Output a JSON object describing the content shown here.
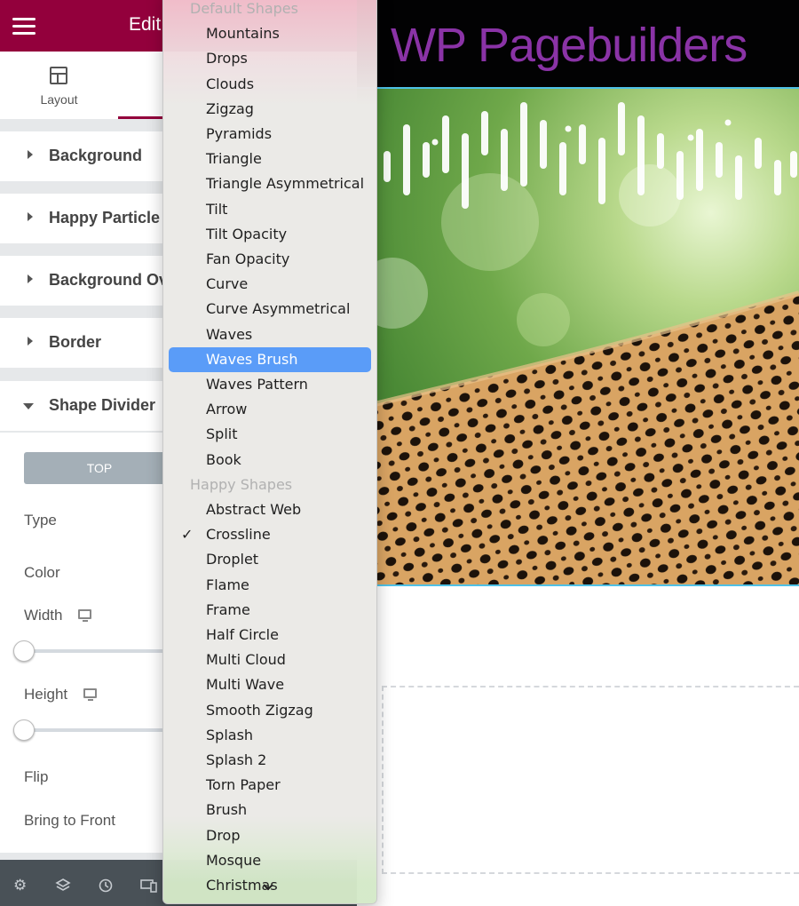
{
  "panel": {
    "title": "Edit",
    "tabs": [
      {
        "label": "Layout",
        "icon": "layout-icon"
      },
      {
        "label": "",
        "icon": "style-icon"
      }
    ],
    "sections": [
      {
        "label": "Background"
      },
      {
        "label": "Happy Particle E"
      },
      {
        "label": "Background Ove"
      },
      {
        "label": "Border"
      },
      {
        "label": "Shape Divider"
      }
    ],
    "shape_divider": {
      "top_button": "TOP",
      "type_label": "Type",
      "color_label": "Color",
      "width_label": "Width",
      "height_label": "Height",
      "flip_label": "Flip",
      "bring_front_label": "Bring to Front",
      "width_value_fraction": 0,
      "height_value_fraction": 0
    },
    "footer_icons": [
      "gear-icon",
      "layers-icon",
      "history-icon",
      "responsive-icon"
    ]
  },
  "preview": {
    "logo": "WP Pagebuilders",
    "accent_color": "#8a33a6",
    "border_color": "#4ec1e6"
  },
  "dropdown": {
    "group_default": "Default Shapes",
    "default_items": [
      "Mountains",
      "Drops",
      "Clouds",
      "Zigzag",
      "Pyramids",
      "Triangle",
      "Triangle Asymmetrical",
      "Tilt",
      "Tilt Opacity",
      "Fan Opacity",
      "Curve",
      "Curve Asymmetrical",
      "Waves",
      "Waves Brush",
      "Waves Pattern",
      "Arrow",
      "Split",
      "Book"
    ],
    "group_happy": "Happy Shapes",
    "happy_items": [
      "Abstract Web",
      "Crossline",
      "Droplet",
      "Flame",
      "Frame",
      "Half Circle",
      "Multi Cloud",
      "Multi Wave",
      "Smooth Zigzag",
      "Splash",
      "Splash 2",
      "Torn Paper",
      "Brush",
      "Drop",
      "Mosque",
      "Christmas"
    ],
    "highlighted": "Waves Brush",
    "selected": "Crossline",
    "highlight_color": "#5a9cf8",
    "check_glyph": "✓",
    "more_icon": "chevron-down-icon"
  }
}
